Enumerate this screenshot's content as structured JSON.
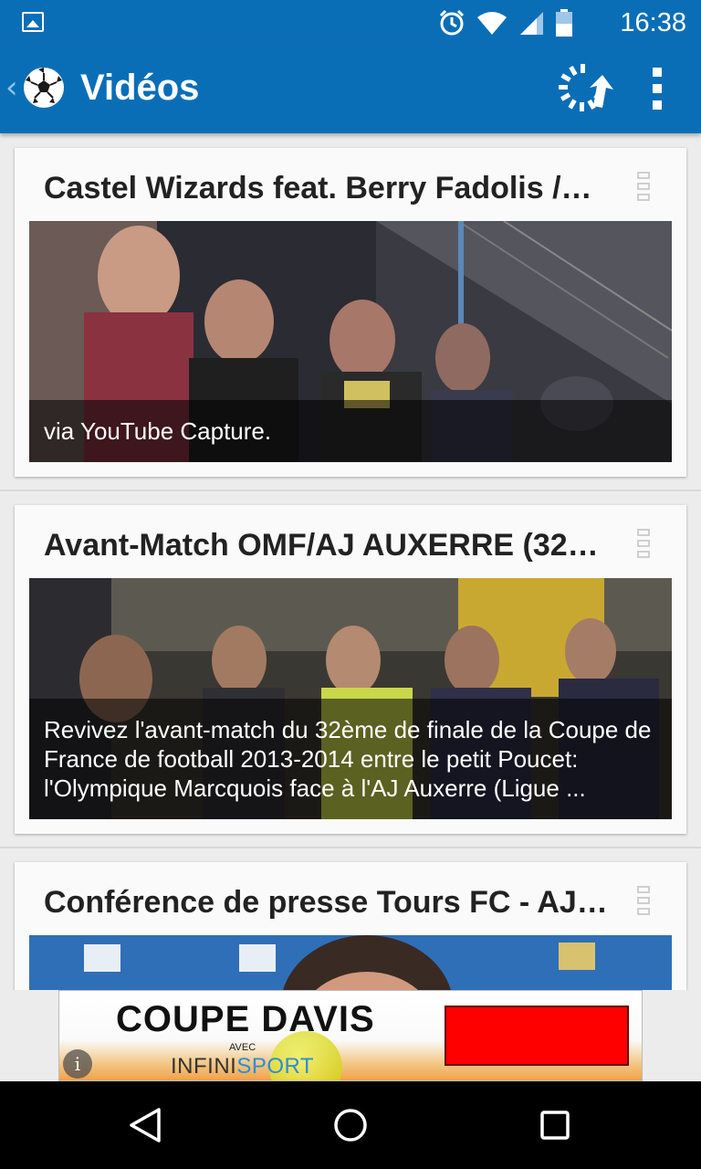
{
  "status_bar": {
    "time": "16:38",
    "icons": [
      "image-icon",
      "alarm-icon",
      "wifi-icon",
      "signal-icon",
      "battery-icon"
    ]
  },
  "app_bar": {
    "title": "Vidéos",
    "color": "#0a6eb7",
    "icons": [
      "back-chevron-icon",
      "soccer-ball-icon",
      "refresh-icon",
      "overflow-menu-icon"
    ]
  },
  "videos": [
    {
      "title": "Castel Wizards feat. Berry Fadolis /…",
      "caption": "via YouTube Capture."
    },
    {
      "title": "Avant-Match OMF/AJ AUXERRE (32…",
      "caption": "Revivez l'avant-match du 32ème de finale de la Coupe de France de football 2013-2014 entre le petit Poucet: l'Olympique Marcquois face à l'AJ Auxerre (Ligue ..."
    },
    {
      "title": "Conférence de presse Tours FC - AJ…",
      "caption": ""
    }
  ],
  "ad": {
    "headline": "COUPE DAVIS",
    "avec": "AVEC",
    "brand_part1": "INFINI",
    "brand_part2": "SPORT",
    "info_icon": "info-icon"
  },
  "nav_bar": {
    "icons": [
      "back-triangle-icon",
      "home-circle-icon",
      "recents-square-icon"
    ]
  }
}
